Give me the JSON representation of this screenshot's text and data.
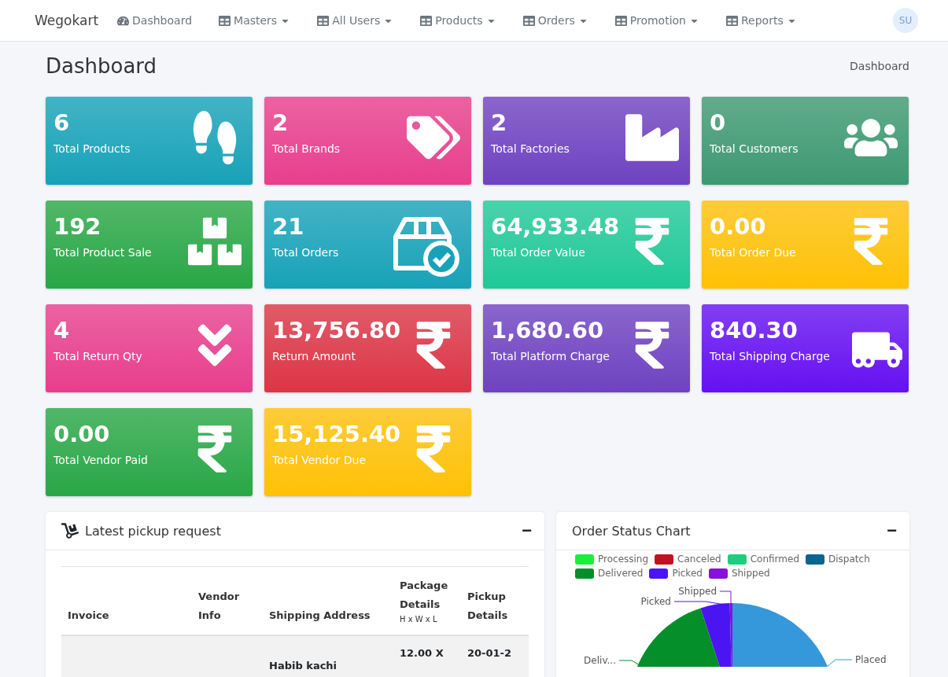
{
  "navbar": {
    "brand": "Wegokart",
    "items": [
      {
        "label": "Dashboard",
        "kind": "link"
      },
      {
        "label": "Masters",
        "kind": "menu"
      },
      {
        "label": "All Users",
        "kind": "menu"
      },
      {
        "label": "Products",
        "kind": "menu"
      },
      {
        "label": "Orders",
        "kind": "menu"
      },
      {
        "label": "Promotion",
        "kind": "menu"
      },
      {
        "label": "Reports",
        "kind": "menu"
      }
    ],
    "avatar": "SU"
  },
  "page": {
    "title": "Dashboard",
    "breadcrumb": "Dashboard"
  },
  "cards": [
    {
      "value": "6",
      "label": "Total Products",
      "color": "#17a2b8"
    },
    {
      "value": "2",
      "label": "Total Brands",
      "color": "#e83e8c"
    },
    {
      "value": "2",
      "label": "Total Factories",
      "color": "#6f42c1"
    },
    {
      "value": "0",
      "label": "Total Customers",
      "color": "#3d9970"
    },
    {
      "value": "192",
      "label": "Total Product Sale",
      "color": "#28a745"
    },
    {
      "value": "21",
      "label": "Total Orders",
      "color": "#17a2b8"
    },
    {
      "value": "64,933.48",
      "label": "Total Order Value",
      "color": "#20c997"
    },
    {
      "value": "0.00",
      "label": "Total Order Due",
      "color": "#ffc107"
    },
    {
      "value": "4",
      "label": "Total Return Qty",
      "color": "#e83e8c"
    },
    {
      "value": "13,756.80",
      "label": "Return Amount",
      "color": "#dc3545"
    },
    {
      "value": "1,680.60",
      "label": "Total Platform Charge",
      "color": "#6f42c1"
    },
    {
      "value": "840.30",
      "label": "Total Shipping Charge",
      "color": "#6610f2"
    },
    {
      "value": "0.00",
      "label": "Total Vendor Paid",
      "color": "#28a745"
    },
    {
      "value": "15,125.40",
      "label": "Total Vendor Due",
      "color": "#ffc107"
    }
  ],
  "pickup": {
    "title": "Latest pickup request",
    "collapse": "−",
    "columns": [
      {
        "label": "Invoice"
      },
      {
        "label": "Vendor Info"
      },
      {
        "label": "Shipping Address"
      },
      {
        "label": "Package Details",
        "sub": "H x W x L"
      },
      {
        "label": "Pickup Details"
      }
    ],
    "rows": [
      {
        "cells": [
          "",
          "",
          "Habib kachi",
          "12.00 X",
          "20-01-2"
        ]
      }
    ]
  },
  "chart": {
    "title": "Order Status Chart",
    "collapse": "−",
    "legend": [
      {
        "label": "Processing",
        "color": "#16f03d"
      },
      {
        "label": "Canceled",
        "color": "#c4111f"
      },
      {
        "label": "Confirmed",
        "color": "#1ccf7e"
      },
      {
        "label": "Dispatch",
        "color": "#0b6591"
      },
      {
        "label": "Delivered",
        "color": "#048f2a"
      },
      {
        "label": "Picked",
        "color": "#4a15f2"
      },
      {
        "label": "Shipped",
        "color": "#8512d9"
      }
    ],
    "slices": [
      {
        "label": "Shipped",
        "color": "#8512d9"
      },
      {
        "label": "Picked",
        "color": "#4a15f2"
      },
      {
        "label": "Deliv...",
        "color": "#048f2a"
      },
      {
        "label": "Placed",
        "color": "#3498db"
      }
    ]
  }
}
